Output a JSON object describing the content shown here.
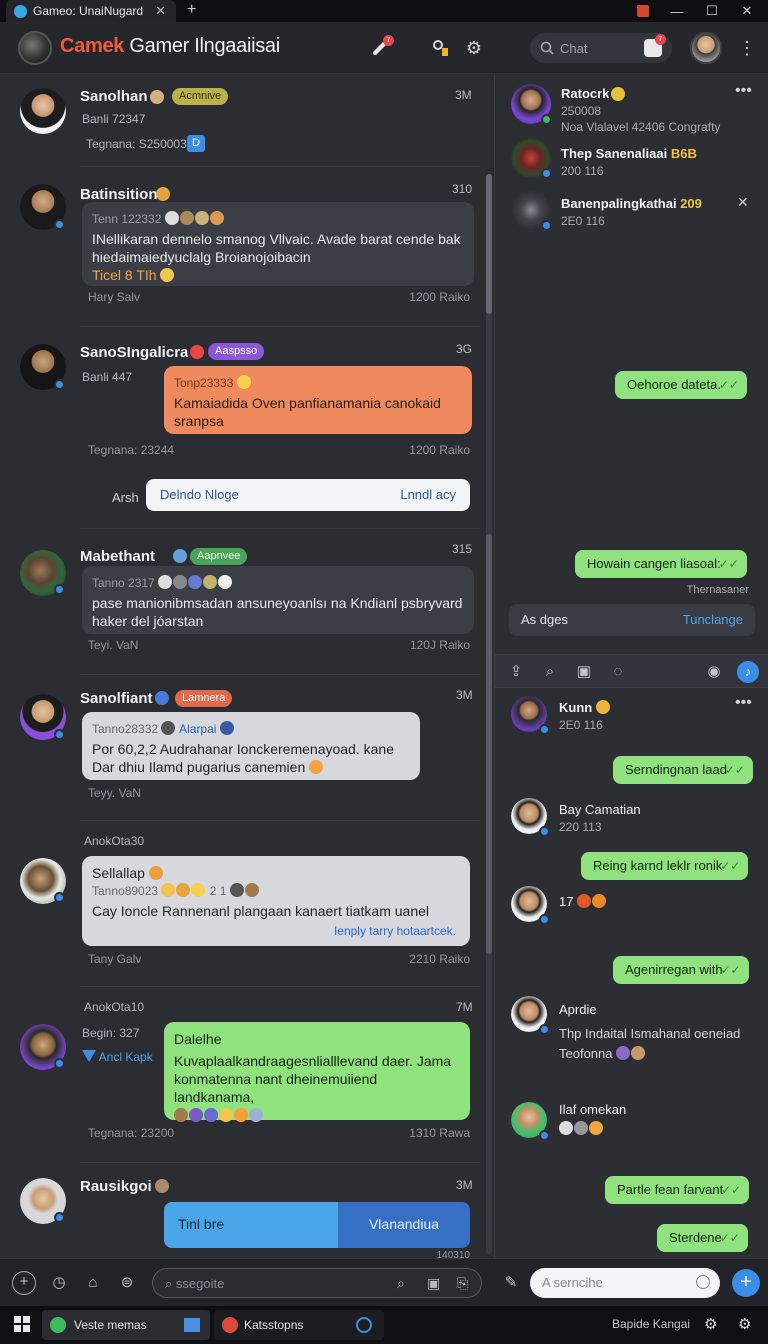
{
  "window": {
    "tab_title": "Gameo: UnaiNugard",
    "tab_close": "✕",
    "new_tab": "+"
  },
  "header": {
    "brand_part1": "Camek",
    "brand_part2": "Gamer Ilngaaiisai",
    "notif_badge": "7",
    "alert_badge": "",
    "search_placeholder": "Chat",
    "chat_badge": "7"
  },
  "colors": {
    "accent_blue": "#3a8ee6",
    "bubble_green": "#8fe27d",
    "bubble_orange": "#ef8a5e",
    "brand_red": "#ef5b3a"
  },
  "messages": [
    {
      "name": "Sanolhan",
      "tag": "Acmnive",
      "time": "3M",
      "meta": "Banli 72347",
      "footer_left": "Tegnana: S250003",
      "footer_badge": "D"
    },
    {
      "name": "Batinsition",
      "time": "310",
      "sub": "Tenn 122332",
      "text": "INellikaran dennelo smanog Vllvaic. Avade barat cende bak hiedaimaiedyuclalg Broianojoibacin",
      "link": "Ticel 8 TIh",
      "footer_left": "Hary Salv",
      "footer_right": "1200 Raiko"
    },
    {
      "name": "SanoSIngalicra",
      "tag": "Aaspsso",
      "time": "3G",
      "meta": "Banli 447",
      "sub": "Tonp23333",
      "text": "Kamaiadida Oven panfianamania canokaid sranpsa",
      "footer_left": "Tegnana: 23244",
      "footer_right": "1200 Raiko"
    },
    {
      "reply_label": "Arsh",
      "reply_value": "Delndo Nloge",
      "reply_action": "Lnndl acy"
    },
    {
      "name": "Mabethant",
      "tag": "Aapnvee",
      "time": "315",
      "sub": "Tanno 2317",
      "text": "pase manionibmsadan ansuneyoanlsı na Kndianl psbryvard haker del jóarstan",
      "footer_left": "Teyi. VaN",
      "footer_right": "120J Raiko"
    },
    {
      "name": "Sanolfiant",
      "tag": "Lamnera",
      "time": "3M",
      "sub": "Tanno28332",
      "sub_link": "Alarpai",
      "text": "Por 60,2,2 Audrahanar Ionckeremenayoad. kane Dar dhiu Ilamd pugarius canemien",
      "footer_left": "Teyy. VaN"
    },
    {
      "header": "AnokOta30",
      "title": "Sellallap",
      "sub": "Tanno89023",
      "text": "Cay Ioncle Rannenanl plangaan kanaert tiatkam uanel",
      "link": "Ienply tarry hotaartcek.",
      "footer_left": "Tany Galv",
      "footer_right": "2210 Raiko"
    },
    {
      "header": "AnokOta10",
      "time": "7M",
      "meta": "Begin: 327",
      "meta2": "Ancl Kapk",
      "title": "Dalelhe",
      "text": "Kuvaplaalkandraagesnlialllevand daer. Jama konmatenna nant dheinemuiiend landkanama,",
      "footer_left": "Tegnana: 23200",
      "footer_right": "1310 Rawa"
    },
    {
      "name": "Rausikgoi",
      "time": "3M",
      "btn_left": "Tinl bre",
      "btn_right": "Vlanandiua",
      "footer_right": "140310"
    }
  ],
  "right_top": {
    "contacts": [
      {
        "name": "Ratocrk",
        "sub": "250008",
        "sub2": "Noa Vlalavel 42406 Congrafty"
      },
      {
        "name": "Thep Sanenaliaai",
        "tag": "B6B",
        "sub": "200 116"
      },
      {
        "name": "Banenpalingkathai",
        "tag": "209",
        "sub": "2E0 116"
      }
    ],
    "out1": "Oehoroe dateta.",
    "out2": "Howain cangen liasoal:",
    "out2_meta": "Thernasaner",
    "reply_label": "As dges",
    "reply_action": "Tunclange"
  },
  "right_bottom": {
    "items": [
      {
        "name": "Kunn",
        "sub": "2E0 116"
      },
      {
        "out": "Serndingnan laad"
      },
      {
        "name": "Bay Camatian",
        "sub": "220 113"
      },
      {
        "out": "Reing karnd leklr ronik"
      },
      {
        "name": "17"
      },
      {
        "out": "Agenirregan with"
      },
      {
        "name": "Aprdie",
        "text": "Thp Indaital Ismahanal oeneiad Teofonna"
      },
      {
        "name": "Ilaf omekan"
      },
      {
        "out": "Partle fean farvant"
      },
      {
        "out": "Sterdene"
      }
    ]
  },
  "composer": {
    "left_placeholder": "ssegoite",
    "right_placeholder": "A serncihe"
  },
  "taskbar": {
    "app1": "Veste memas",
    "app2": "Katsstopns",
    "right_text": "Bapide Kangai"
  }
}
